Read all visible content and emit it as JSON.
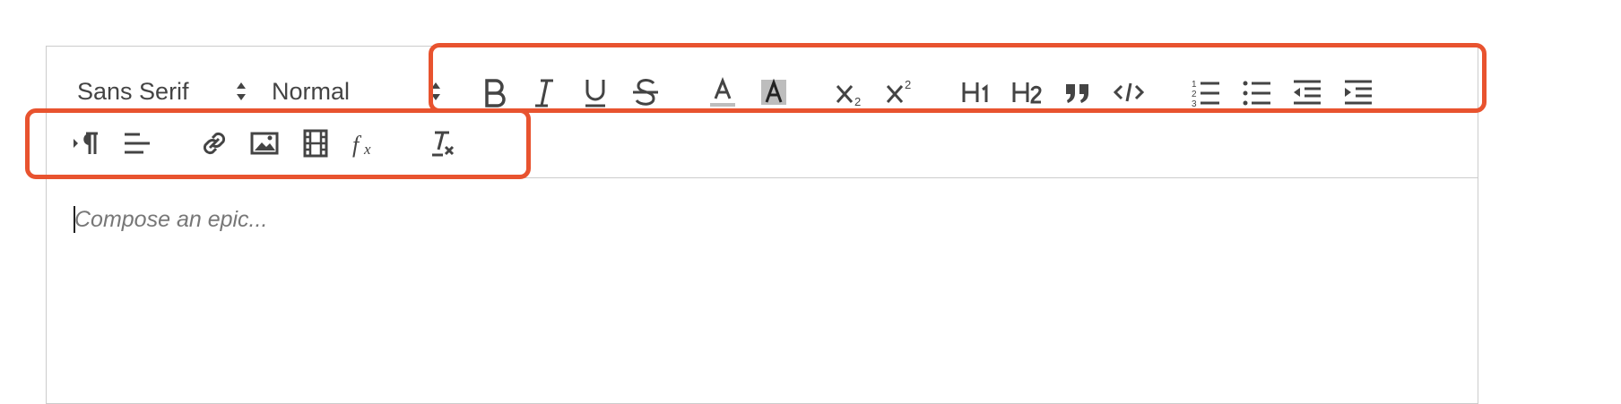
{
  "toolbar": {
    "font_picker": {
      "value": "Sans Serif",
      "icon": "up-down-arrows-icon"
    },
    "size_picker": {
      "value": "Normal",
      "icon": "up-down-arrows-icon"
    },
    "buttons": [
      {
        "name": "bold-button",
        "icon": "bold-icon"
      },
      {
        "name": "italic-button",
        "icon": "italic-icon"
      },
      {
        "name": "underline-button",
        "icon": "underline-icon"
      },
      {
        "name": "strikethrough-button",
        "icon": "strike-icon"
      },
      {
        "name": "text-color-button",
        "icon": "text-color-icon"
      },
      {
        "name": "background-color-button",
        "icon": "background-color-icon"
      },
      {
        "name": "subscript-button",
        "icon": "subscript-icon"
      },
      {
        "name": "superscript-button",
        "icon": "superscript-icon"
      },
      {
        "name": "header-1-button",
        "icon": "h1-icon"
      },
      {
        "name": "header-2-button",
        "icon": "h2-icon"
      },
      {
        "name": "blockquote-button",
        "icon": "quote-icon"
      },
      {
        "name": "code-block-button",
        "icon": "code-icon"
      },
      {
        "name": "ordered-list-button",
        "icon": "ordered-list-icon"
      },
      {
        "name": "bullet-list-button",
        "icon": "bullet-list-icon"
      },
      {
        "name": "outdent-button",
        "icon": "outdent-icon"
      },
      {
        "name": "indent-button",
        "icon": "indent-icon"
      },
      {
        "name": "text-direction-button",
        "icon": "paragraph-direction-icon"
      },
      {
        "name": "align-button",
        "icon": "align-left-icon"
      },
      {
        "name": "link-button",
        "icon": "link-icon"
      },
      {
        "name": "image-button",
        "icon": "image-icon"
      },
      {
        "name": "video-button",
        "icon": "video-icon"
      },
      {
        "name": "formula-button",
        "icon": "formula-icon"
      },
      {
        "name": "clean-formatting-button",
        "icon": "clear-format-icon"
      }
    ]
  },
  "editor": {
    "placeholder": "Compose an epic..."
  },
  "colors": {
    "highlight": "#e8532f",
    "border": "#cccccc",
    "icon": "#444444"
  }
}
